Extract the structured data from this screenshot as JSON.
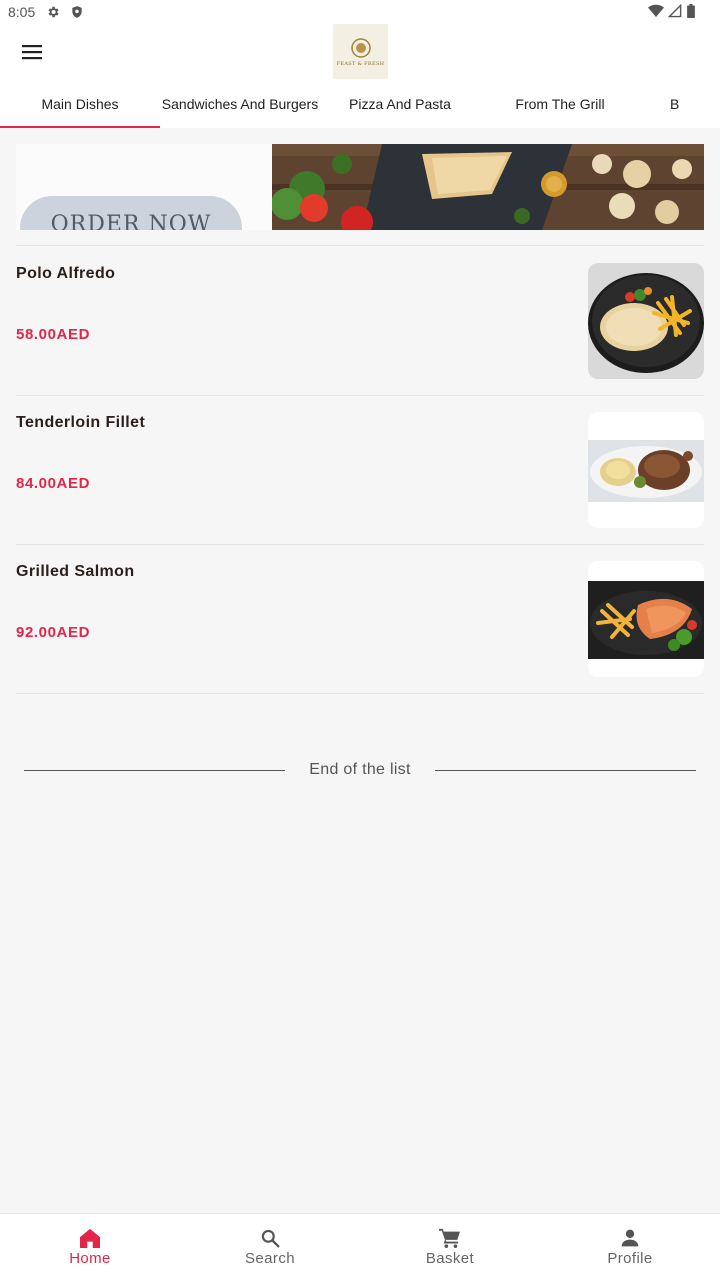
{
  "status_bar": {
    "time": "8:05"
  },
  "tabs": [
    {
      "label": "Main Dishes"
    },
    {
      "label": "Sandwiches And Burgers"
    },
    {
      "label": "Pizza And Pasta"
    },
    {
      "label": "From The Grill"
    },
    {
      "label": "B"
    }
  ],
  "banner": {
    "order_label": "ORDER NOW"
  },
  "items": [
    {
      "name": "Polo Alfredo",
      "price": "58.00AED"
    },
    {
      "name": "Tenderloin Fillet",
      "price": "84.00AED"
    },
    {
      "name": "Grilled Salmon",
      "price": "92.00AED"
    }
  ],
  "end_of_list": "End of the list",
  "bottom_nav": [
    {
      "label": "Home",
      "icon": "home-icon"
    },
    {
      "label": "Search",
      "icon": "search-icon"
    },
    {
      "label": "Basket",
      "icon": "cart-icon"
    },
    {
      "label": "Profile",
      "icon": "person-icon"
    }
  ],
  "colors": {
    "accent": "#e2264a",
    "background": "#f6f6f6"
  }
}
